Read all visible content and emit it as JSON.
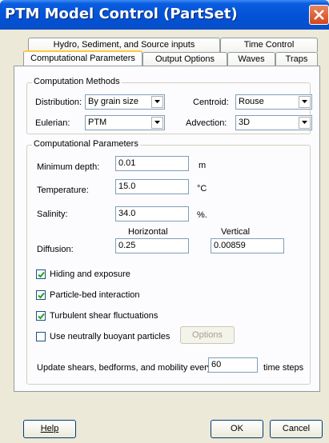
{
  "window": {
    "title": "PTM Model Control (PartSet)"
  },
  "tabs": {
    "row1": [
      "Hydro, Sediment, and Source inputs",
      "Time Control"
    ],
    "row2": [
      "Computational Parameters",
      "Output Options",
      "Waves",
      "Traps"
    ],
    "active": "Computational Parameters"
  },
  "methods": {
    "legend": "Computation Methods",
    "distribution_label": "Distribution:",
    "distribution_value": "By grain size",
    "centroid_label": "Centroid:",
    "centroid_value": "Rouse",
    "eulerian_label": "Eulerian:",
    "eulerian_value": "PTM",
    "advection_label": "Advection:",
    "advection_value": "3D"
  },
  "params": {
    "legend": "Computational Parameters",
    "min_depth_label": "Minimum depth:",
    "min_depth_value": "0.01",
    "min_depth_unit": "m",
    "temperature_label": "Temperature:",
    "temperature_value": "15.0",
    "temperature_unit": "°C",
    "salinity_label": "Salinity:",
    "salinity_value": "34.0",
    "salinity_unit": "%.",
    "diffusion_label": "Diffusion:",
    "horizontal_label": "Horizontal",
    "horizontal_value": "0.25",
    "vertical_label": "Vertical",
    "vertical_value": "0.00859"
  },
  "checkboxes": [
    {
      "label": "Hiding and exposure",
      "checked": true
    },
    {
      "label": "Particle-bed interaction",
      "checked": true
    },
    {
      "label": "Turbulent shear fluctuations",
      "checked": true
    },
    {
      "label": "Use neutrally buoyant particles",
      "checked": false
    }
  ],
  "options_button": "Options",
  "update": {
    "prefix": "Update shears, bedforms, and mobility every",
    "value": "60",
    "suffix": "time steps"
  },
  "buttons": {
    "help": "Help",
    "ok": "OK",
    "cancel": "Cancel"
  },
  "colors": {
    "title_bar": "#0454d8",
    "close": "#d2461c",
    "tab_highlight": "#ffc83c"
  }
}
